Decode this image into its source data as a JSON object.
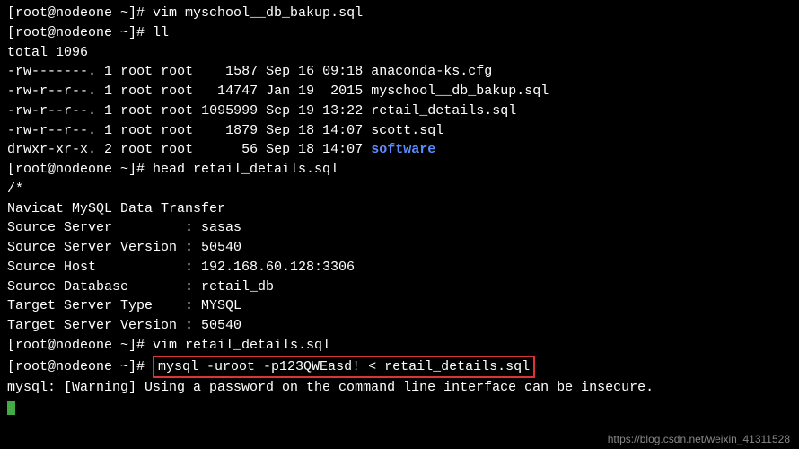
{
  "prompt": "[root@nodeone ~]# ",
  "commands": {
    "cmd1": "vim myschool__db_bakup.sql",
    "cmd2": "ll",
    "cmd3": "head retail_details.sql",
    "cmd4": "vim retail_details.sql",
    "cmd5": "mysql -uroot -p123QWEasd! < retail_details.sql"
  },
  "ll_output": {
    "total": "total 1096",
    "rows": [
      {
        "perm": "-rw-------.",
        "links": "1",
        "owner": "root",
        "group": "root",
        "size": "   1587",
        "date": "Sep 16 09:18",
        "name": "anaconda-ks.cfg"
      },
      {
        "perm": "-rw-r--r--.",
        "links": "1",
        "owner": "root",
        "group": "root",
        "size": "  14747",
        "date": "Jan 19  2015",
        "name": "myschool__db_bakup.sql"
      },
      {
        "perm": "-rw-r--r--.",
        "links": "1",
        "owner": "root",
        "group": "root",
        "size": "1095999",
        "date": "Sep 19 13:22",
        "name": "retail_details.sql"
      },
      {
        "perm": "-rw-r--r--.",
        "links": "1",
        "owner": "root",
        "group": "root",
        "size": "   1879",
        "date": "Sep 18 14:07",
        "name": "scott.sql"
      },
      {
        "perm": "drwxr-xr-x.",
        "links": "2",
        "owner": "root",
        "group": "root",
        "size": "     56",
        "date": "Sep 18 14:07",
        "name": "software"
      }
    ]
  },
  "head_output": {
    "l1": "/*",
    "l2": "Navicat MySQL Data Transfer",
    "l3": "",
    "l4": "Source Server         : sasas",
    "l5": "Source Server Version : 50540",
    "l6": "Source Host           : 192.168.60.128:3306",
    "l7": "Source Database       : retail_db",
    "l8": "",
    "l9": "Target Server Type    : MYSQL",
    "l10": "Target Server Version : 50540"
  },
  "warning": "mysql: [Warning] Using a password on the command line interface can be insecure.",
  "watermark": "https://blog.csdn.net/weixin_41311528"
}
